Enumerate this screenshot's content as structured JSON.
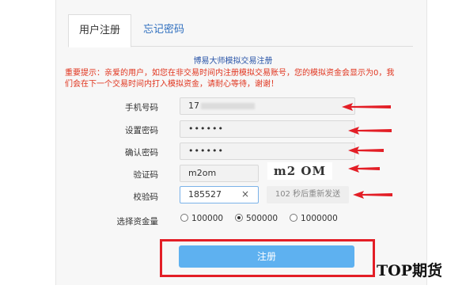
{
  "tabs": [
    {
      "label": "用户注册",
      "active": true
    },
    {
      "label": "忘记密码",
      "active": false
    }
  ],
  "form": {
    "title": "博易大师模拟交易注册",
    "notice": "重要提示：亲爱的用户，如您在非交易时间内注册模拟交易账号，您的模拟资金会显示为0，我们会在下一个交易时间内打入模拟资金，请耐心等待，谢谢！",
    "phone": {
      "label": "手机号码",
      "value": "17"
    },
    "password": {
      "label": "设置密码",
      "value": "••••••"
    },
    "confirm_password": {
      "label": "确认密码",
      "value": "••••••"
    },
    "captcha": {
      "label": "验证码",
      "value": "m2om",
      "image_text": "m2 OM"
    },
    "verify_code": {
      "label": "校验码",
      "value": "185527",
      "clear": "×",
      "countdown": "102 秒后重新发送"
    },
    "funds": {
      "label": "选择资金量",
      "options": [
        "100000",
        "500000",
        "1000000"
      ],
      "selected": "500000"
    },
    "submit_label": "注册"
  },
  "watermark": "TOP期货",
  "colors": {
    "notice": "#e0341e",
    "title": "#2a55a8",
    "tab_link": "#2f6fbf",
    "button": "#5eb1f0",
    "annotation": "#e31e26"
  }
}
